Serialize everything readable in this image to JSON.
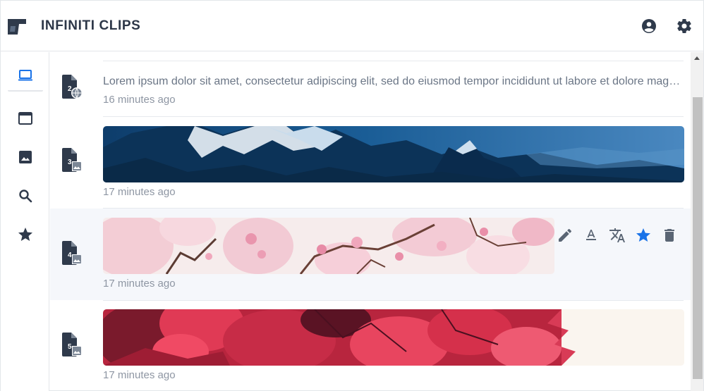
{
  "app": {
    "title": "INFINITI CLIPS"
  },
  "header": {
    "account_icon": "account-circle-icon",
    "settings_icon": "gear-icon"
  },
  "sidebar": {
    "items": [
      {
        "name": "all-clips",
        "icon": "laptop-icon",
        "active": true
      },
      {
        "name": "window-clips",
        "icon": "window-icon",
        "active": false
      },
      {
        "name": "image-clips",
        "icon": "image-icon",
        "active": false
      },
      {
        "name": "search",
        "icon": "search-icon",
        "active": false
      },
      {
        "name": "favorites",
        "icon": "star-icon",
        "active": false
      }
    ]
  },
  "clips": [
    {
      "number": "2",
      "type": "text",
      "badge": "globe-icon",
      "text": "Lorem ipsum dolor sit amet, consectetur adipiscing elit, sed do eiusmod tempor incididunt ut labore et dolore magna aliqua.",
      "time": "16 minutes ago"
    },
    {
      "number": "3",
      "type": "image",
      "badge": "image-icon",
      "image": "mountains",
      "time": "17 minutes ago"
    },
    {
      "number": "4",
      "type": "image",
      "badge": "image-icon",
      "image": "cherry-blossoms",
      "time": "17 minutes ago",
      "hovered": true
    },
    {
      "number": "5",
      "type": "image",
      "badge": "image-icon",
      "image": "red-leaves",
      "time": "17 minutes ago"
    }
  ],
  "actions": [
    {
      "name": "edit",
      "icon": "pencil-icon"
    },
    {
      "name": "format",
      "icon": "text-format-icon"
    },
    {
      "name": "translate",
      "icon": "translate-icon"
    },
    {
      "name": "favorite",
      "icon": "star-icon",
      "active": true
    },
    {
      "name": "delete",
      "icon": "trash-icon"
    }
  ],
  "colors": {
    "icon": "#2f3a4b",
    "accent": "#1a73e8",
    "muted": "#8e96a3",
    "hover_bg": "#f5f7fb"
  }
}
